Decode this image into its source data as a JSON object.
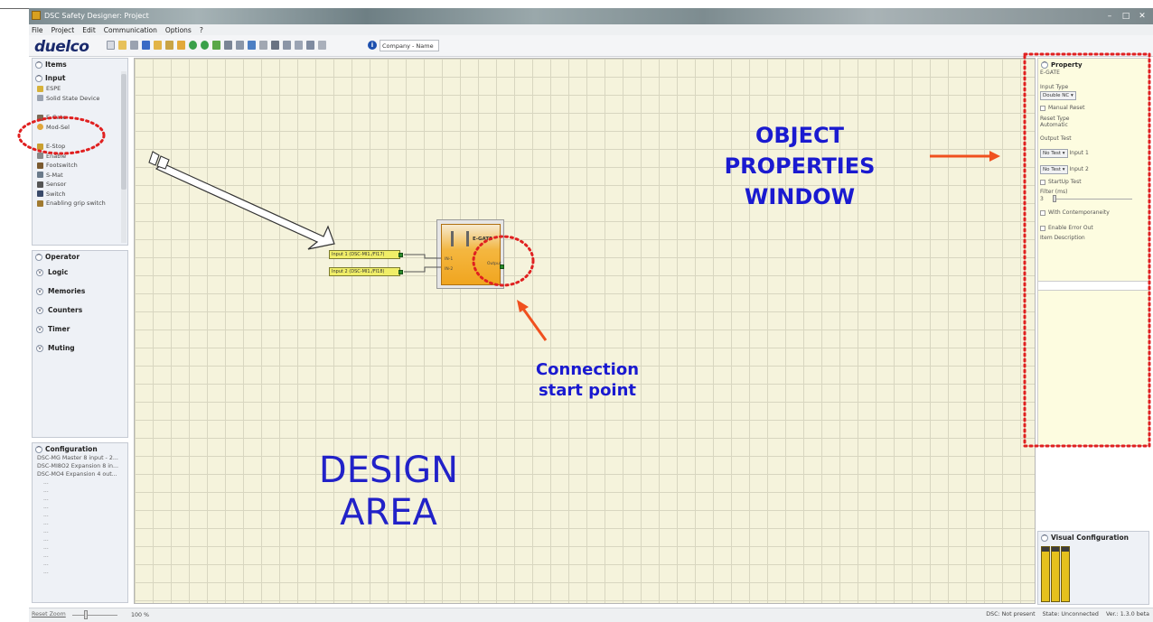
{
  "window": {
    "title": "DSC Safety Designer: Project"
  },
  "menu": [
    "File",
    "Project",
    "Edit",
    "Communication",
    "Options",
    "?"
  ],
  "toolbar": {
    "logo": "duelco",
    "company_placeholder": "Company - Name"
  },
  "items_panel": {
    "title": "Items",
    "input_section": "Input",
    "items": [
      "ESPE",
      "Solid State Device",
      "E-Gate",
      "Mod-Sel",
      "E-Stop",
      "Enable",
      "Footswitch",
      "S-Mat",
      "Sensor",
      "Switch",
      "Enabling grip switch"
    ]
  },
  "operator_panel": {
    "title": "Operator",
    "rows": [
      "Logic",
      "Memories",
      "Counters",
      "Timer",
      "Muting"
    ]
  },
  "config_panel": {
    "title": "Configuration",
    "lines": [
      "DSC-MG Master 8 input - 2...",
      "DSC-MI8O2 Expansion 8 in...",
      "DSC-MO4 Expansion 4 out..."
    ],
    "placeholders": [
      "...",
      "...",
      "...",
      "...",
      "...",
      "...",
      "...",
      "...",
      "...",
      "...",
      "...",
      "..."
    ]
  },
  "design": {
    "input1_label": "Input 1 (DSC-MI1./FI17)",
    "input2_label": "Input 2 (DSC-MI1./FI18)",
    "gate_title": "E-GATE",
    "gate_in1": "IN-1",
    "gate_in2": "IN-2",
    "gate_out": "Output",
    "area_line1": "DESIGN",
    "area_line2": "AREA",
    "props_line1": "OBJECT",
    "props_line2": "PROPERTIES",
    "props_line3": "WINDOW",
    "conn_line1": "Connection",
    "conn_line2": "start point"
  },
  "property_panel": {
    "title": "Property",
    "object_name": "E-GATE",
    "input_type_label": "Input Type",
    "input_type_value": "Double NC",
    "manual_reset_label": "Manual Reset",
    "reset_type_label": "Reset Type",
    "reset_type_value": "Automatic",
    "output_test_label": "Output Test",
    "no_test_1": "No Test",
    "input1_label": "Input 1",
    "no_test_2": "No Test",
    "input2_label": "Input 2",
    "startup_test_label": "StartUp Test",
    "filter_label": "Filter (ms)",
    "filter_value": "3",
    "contemporaneity_label": "With Contemporaneity",
    "error_out_label": "Enable Error Out",
    "item_description_label": "Item Description"
  },
  "visual_panel": {
    "title": "Visual Configuration"
  },
  "statusbar": {
    "reset_zoom": "Reset Zoom",
    "zoom_value": "100 %",
    "dsc_status": "DSC: Not present",
    "state": "State: Unconnected",
    "version": "Ver.: 1.3.0 beta"
  },
  "colors": {
    "annotation_blue": "#1a1ad0",
    "annotation_red": "#e02020",
    "arrow_orange": "#f0501e"
  }
}
